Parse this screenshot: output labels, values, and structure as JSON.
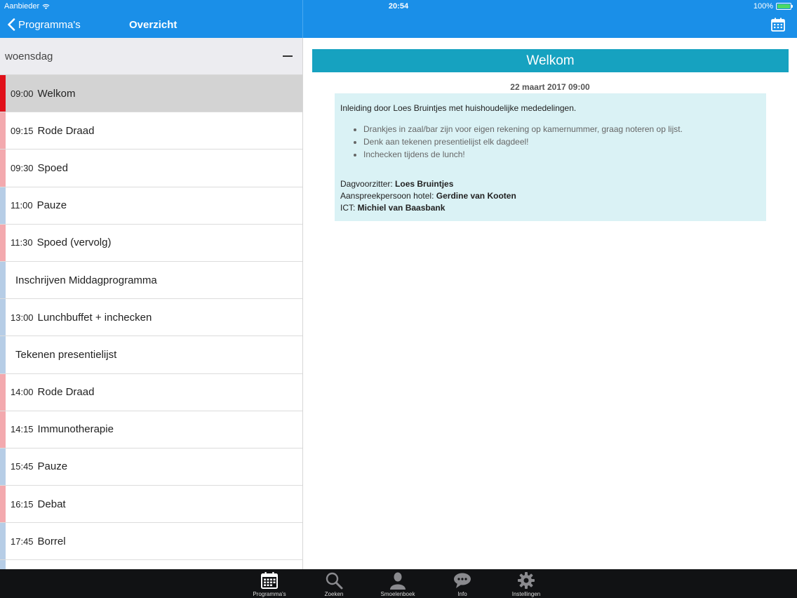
{
  "status": {
    "carrier": "Aanbieder",
    "time": "20:54",
    "battery": "100%"
  },
  "nav": {
    "back_label": "Programma's",
    "title": "Overzicht"
  },
  "schedule": {
    "day": "woensdag",
    "items": [
      {
        "time": "09:00",
        "title": "Welkom",
        "stripe": "#e0101a",
        "selected": true
      },
      {
        "time": "09:15",
        "title": "Rode Draad",
        "stripe": "#f3a9ae",
        "selected": false
      },
      {
        "time": "09:30",
        "title": "Spoed",
        "stripe": "#f3a9ae",
        "selected": false
      },
      {
        "time": "11:00",
        "title": "Pauze",
        "stripe": "#b6cde6",
        "selected": false
      },
      {
        "time": "11:30",
        "title": "Spoed (vervolg)",
        "stripe": "#f3a9ae",
        "selected": false
      },
      {
        "time": "",
        "title": "Inschrijven Middagprogramma",
        "stripe": "#b6cde6",
        "selected": false
      },
      {
        "time": "13:00",
        "title": "Lunchbuffet + inchecken",
        "stripe": "#b6cde6",
        "selected": false
      },
      {
        "time": "",
        "title": "Tekenen presentielijst",
        "stripe": "#b6cde6",
        "selected": false
      },
      {
        "time": "14:00",
        "title": "Rode Draad",
        "stripe": "#f3a9ae",
        "selected": false
      },
      {
        "time": "14:15",
        "title": "Immunotherapie",
        "stripe": "#f3a9ae",
        "selected": false
      },
      {
        "time": "15:45",
        "title": "Pauze",
        "stripe": "#b6cde6",
        "selected": false
      },
      {
        "time": "16:15",
        "title": "Debat",
        "stripe": "#f3a9ae",
        "selected": false
      },
      {
        "time": "17:45",
        "title": "Borrel",
        "stripe": "#b6cde6",
        "selected": false
      },
      {
        "time": "",
        "title": "",
        "stripe": "#b6cde6",
        "selected": false
      }
    ]
  },
  "detail": {
    "title": "Welkom",
    "datetime": "22 maart 2017 09:00",
    "intro": "Inleiding door Loes Bruintjes met huishoudelijke mededelingen.",
    "bullets": [
      "Drankjes in zaal/bar zijn voor eigen rekening op kamernummer, graag noteren op lijst.",
      "Denk aan tekenen presentielijst elk dagdeel!",
      "Inchecken tijdens de lunch!"
    ],
    "people": [
      {
        "role": "Dagvoorzitter: ",
        "name": "Loes Bruintjes"
      },
      {
        "role": "Aanspreekpersoon hotel: ",
        "name": "Gerdine van Kooten"
      },
      {
        "role": "ICT: ",
        "name": "Michiel van Baasbank"
      }
    ]
  },
  "tabs": [
    {
      "label": "Programma's",
      "icon": "calendar-icon"
    },
    {
      "label": "Zoeken",
      "icon": "search-icon"
    },
    {
      "label": "Smoelenboek",
      "icon": "person-icon"
    },
    {
      "label": "Info",
      "icon": "chat-bubble-icon"
    },
    {
      "label": "Instellingen",
      "icon": "gear-icon"
    }
  ],
  "colors": {
    "nav_blue": "#1a8fe8",
    "welcome_teal": "#16a2c0",
    "info_bg": "#daf2f5",
    "tabbar": "#111214"
  }
}
